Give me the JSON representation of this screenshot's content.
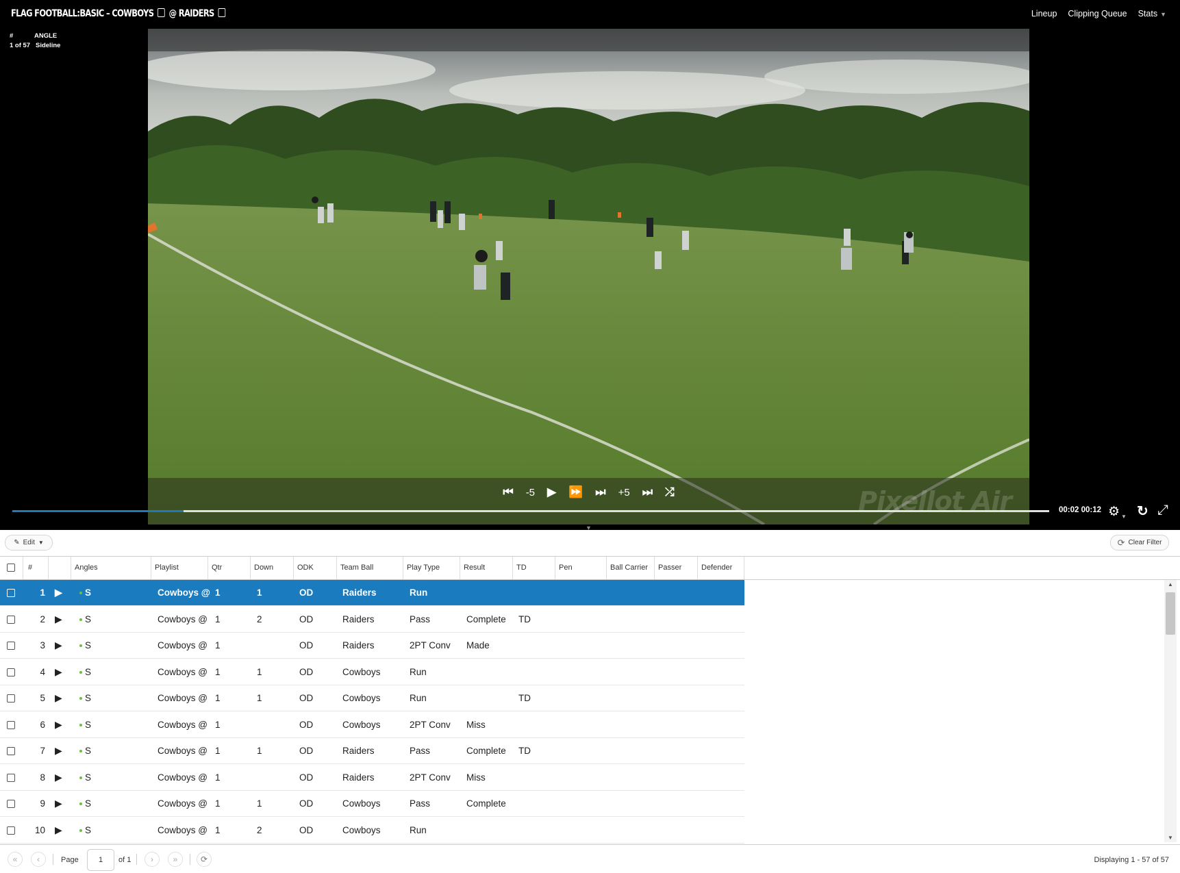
{
  "header": {
    "title_part1": "FLAG FOOTBALL:BASIC – COWBOYS",
    "title_part2": "@ RAIDERS",
    "nav": {
      "lineup": "Lineup",
      "clipping_queue": "Clipping Queue",
      "stats": "Stats"
    }
  },
  "player": {
    "clip_label": "#",
    "angle_label": "ANGLE",
    "clip_position": "1 of 57",
    "angle_value": "Sideline",
    "skip_back": "-5",
    "skip_forward": "+5",
    "watermark": "Pixellot Air",
    "current_time": "00:02",
    "duration": "00:12",
    "progress": 0.165
  },
  "toolbar": {
    "edit_label": "Edit",
    "clear_filter_label": "Clear Filter"
  },
  "grid": {
    "columns": [
      "#",
      "Angles",
      "Playlist",
      "Qtr",
      "Down",
      "ODK",
      "Team Ball",
      "Play Type",
      "Result",
      "TD",
      "Pen",
      "Ball Carrier",
      "Passer",
      "Defender"
    ],
    "rows": [
      {
        "num": "1",
        "angle": "S",
        "playlist": "Cowboys @",
        "qtr": "1",
        "down": "1",
        "odk": "OD",
        "team": "Raiders",
        "type": "Run",
        "result": "",
        "td": "",
        "selected": true
      },
      {
        "num": "2",
        "angle": "S",
        "playlist": "Cowboys @",
        "qtr": "1",
        "down": "2",
        "odk": "OD",
        "team": "Raiders",
        "type": "Pass",
        "result": "Complete",
        "td": "TD",
        "selected": false
      },
      {
        "num": "3",
        "angle": "S",
        "playlist": "Cowboys @",
        "qtr": "1",
        "down": "",
        "odk": "OD",
        "team": "Raiders",
        "type": "2PT Conv",
        "result": "Made",
        "td": "",
        "selected": false
      },
      {
        "num": "4",
        "angle": "S",
        "playlist": "Cowboys @",
        "qtr": "1",
        "down": "1",
        "odk": "OD",
        "team": "Cowboys",
        "type": "Run",
        "result": "",
        "td": "",
        "selected": false
      },
      {
        "num": "5",
        "angle": "S",
        "playlist": "Cowboys @",
        "qtr": "1",
        "down": "1",
        "odk": "OD",
        "team": "Cowboys",
        "type": "Run",
        "result": "",
        "td": "TD",
        "selected": false
      },
      {
        "num": "6",
        "angle": "S",
        "playlist": "Cowboys @",
        "qtr": "1",
        "down": "",
        "odk": "OD",
        "team": "Cowboys",
        "type": "2PT Conv",
        "result": "Miss",
        "td": "",
        "selected": false
      },
      {
        "num": "7",
        "angle": "S",
        "playlist": "Cowboys @",
        "qtr": "1",
        "down": "1",
        "odk": "OD",
        "team": "Raiders",
        "type": "Pass",
        "result": "Complete",
        "td": "TD",
        "selected": false
      },
      {
        "num": "8",
        "angle": "S",
        "playlist": "Cowboys @",
        "qtr": "1",
        "down": "",
        "odk": "OD",
        "team": "Raiders",
        "type": "2PT Conv",
        "result": "Miss",
        "td": "",
        "selected": false
      },
      {
        "num": "9",
        "angle": "S",
        "playlist": "Cowboys @",
        "qtr": "1",
        "down": "1",
        "odk": "OD",
        "team": "Cowboys",
        "type": "Pass",
        "result": "Complete",
        "td": "",
        "selected": false
      },
      {
        "num": "10",
        "angle": "S",
        "playlist": "Cowboys @",
        "qtr": "1",
        "down": "2",
        "odk": "OD",
        "team": "Cowboys",
        "type": "Run",
        "result": "",
        "td": "",
        "selected": false
      }
    ]
  },
  "pager": {
    "page_label": "Page",
    "page_value": "1",
    "of_label": "of 1",
    "display_text": "Displaying 1 - 57 of 57"
  },
  "colors": {
    "accent": "#1a7bbf",
    "topbar": "#000000",
    "progress": "#1d7cb8"
  },
  "icons": [
    "pencil-icon",
    "caret-down-icon",
    "refresh-icon",
    "skip-start-icon",
    "play-icon",
    "fast-forward-icon",
    "skip-next-icon",
    "skip-end-icon",
    "shuffle-icon",
    "gear-icon",
    "reload-icon",
    "fullscreen-icon",
    "first-page-icon",
    "prev-page-icon",
    "next-page-icon",
    "last-page-icon"
  ]
}
